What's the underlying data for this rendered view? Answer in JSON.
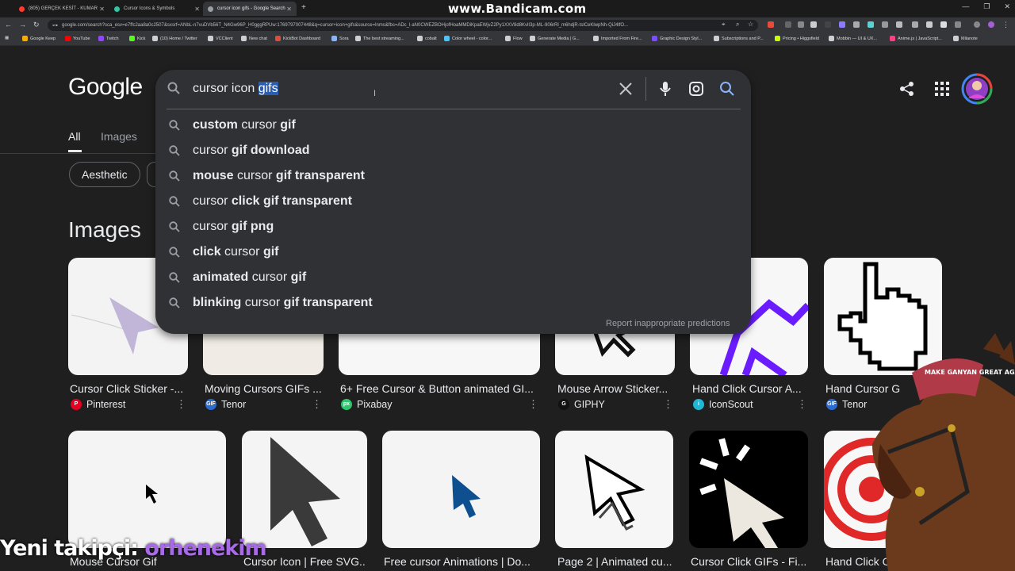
{
  "browser": {
    "tabs": [
      {
        "title": "(805) GERÇEK KESİT - KUMAR",
        "color": "#ff3b30"
      },
      {
        "title": "Cursor Icons & Symbols",
        "color": "#35c4a6"
      },
      {
        "title": "cursor icon gifs - Google Search",
        "color": "#9aa0a6"
      }
    ],
    "new_tab": "+",
    "watermark": "www.Bandicam.com",
    "url": "google.com/search?sca_esv=e7ffc2aa8a0c2507&sxsrf=ANbL-n7vuDVb56T_N4Gw96P_H0gggRPUw:1769797007448&q=cursor+icon+gifs&source=lnms&fbs=ADc_l-aN0CWEZBOHjofHoaMMDiKpaEWjvZ2Py1XXV8d8KvlI3p-ML-906rRl_m6hdjR-tslCeKlwpNh-QiJ4lfO...",
    "bookmarks": [
      {
        "label": "Google Keep",
        "color": "#f9ab00"
      },
      {
        "label": "YouTube",
        "color": "#ff0000"
      },
      {
        "label": "Twitch",
        "color": "#9146ff"
      },
      {
        "label": "Kick",
        "color": "#53fc18"
      },
      {
        "label": "(10) Home / Twitter",
        "color": "#cfcfcf"
      },
      {
        "label": "VCClient",
        "color": "#cfcfcf"
      },
      {
        "label": "New chat",
        "color": "#cfcfcf"
      },
      {
        "label": "KickBot Dashboard",
        "color": "#e04b3a"
      },
      {
        "label": "Sora",
        "color": "#8ab4f8"
      },
      {
        "label": "The best streaming...",
        "color": "#cfcfcf"
      },
      {
        "label": "cobalt",
        "color": "#cfcfcf"
      },
      {
        "label": "Color wheel - color...",
        "color": "#4fc3f7"
      },
      {
        "label": "Flow",
        "color": "#cfcfcf"
      },
      {
        "label": "Generate Media | G...",
        "color": "#cfcfcf"
      },
      {
        "label": "Imported From Fire...",
        "color": "#cfcfcf"
      },
      {
        "label": "Graphic Design Styl...",
        "color": "#7c4dff"
      },
      {
        "label": "Subscriptions and P...",
        "color": "#cfcfcf"
      },
      {
        "label": "Pricing • Higgsfield",
        "color": "#c6ff00"
      },
      {
        "label": "Mobbin — UI & UX...",
        "color": "#cfcfcf"
      },
      {
        "label": "Anime.js | JavaScript...",
        "color": "#ff4081"
      },
      {
        "label": "Milanote",
        "color": "#cfcfcf"
      }
    ]
  },
  "logo": "Google",
  "search": {
    "query_plain": "cursor icon ",
    "query_selected": "gifs",
    "suggestions": [
      [
        {
          "t": "custom",
          "b": true
        },
        {
          "t": " cursor ",
          "b": false
        },
        {
          "t": "gif",
          "b": true
        }
      ],
      [
        {
          "t": "cursor ",
          "b": false
        },
        {
          "t": "gif download",
          "b": true
        }
      ],
      [
        {
          "t": "mouse",
          "b": true
        },
        {
          "t": " cursor ",
          "b": false
        },
        {
          "t": "gif transparent",
          "b": true
        }
      ],
      [
        {
          "t": "cursor ",
          "b": false
        },
        {
          "t": "click gif transparent",
          "b": true
        }
      ],
      [
        {
          "t": "cursor ",
          "b": false
        },
        {
          "t": "gif png",
          "b": true
        }
      ],
      [
        {
          "t": "click",
          "b": true
        },
        {
          "t": " cursor ",
          "b": false
        },
        {
          "t": "gif",
          "b": true
        }
      ],
      [
        {
          "t": "animated",
          "b": true
        },
        {
          "t": " cursor ",
          "b": false
        },
        {
          "t": "gif",
          "b": true
        }
      ],
      [
        {
          "t": "blinking",
          "b": true
        },
        {
          "t": " cursor ",
          "b": false
        },
        {
          "t": "gif transparent",
          "b": true
        }
      ]
    ],
    "report": "Report inappropriate predictions"
  },
  "tabs": {
    "all": "All",
    "images": "Images"
  },
  "chips": {
    "aesthetic": "Aesthetic"
  },
  "section_title": "Images",
  "row1": [
    {
      "caption": "Cursor Click Sticker -...",
      "source": "Pinterest",
      "src_color": "#e60023",
      "src_letter": "P"
    },
    {
      "caption": "Moving Cursors GIFs ...",
      "source": "Tenor",
      "src_color": "#2b6cd4",
      "src_letter": "GIF"
    },
    {
      "caption": "6+ Free Cursor & Button animated GI...",
      "source": "Pixabay",
      "src_color": "#2ec66d",
      "src_letter": "px"
    },
    {
      "caption": "Mouse Arrow Sticker...",
      "source": "GIPHY",
      "src_color": "#111111",
      "src_letter": "G"
    },
    {
      "caption": "Hand Click Cursor A...",
      "source": "IconScout",
      "src_color": "#1fb7d4",
      "src_letter": "i"
    },
    {
      "caption": "Hand Cursor G",
      "source": "Tenor",
      "src_color": "#2b6cd4",
      "src_letter": "GIF"
    }
  ],
  "row2": [
    {
      "caption": "Mouse Cursor Gif"
    },
    {
      "caption": "Cursor Icon | Free SVG..."
    },
    {
      "caption": "Free cursor Animations | Do..."
    },
    {
      "caption": "Page 2 | Animated cu..."
    },
    {
      "caption": "Cursor Click GIFs - Fi..."
    },
    {
      "caption": "Hand Click Cursor A..."
    }
  ],
  "overlay": {
    "prefix": "Yeni takipçi: ",
    "name": "orhenekim"
  },
  "horse_hat_text": "MAKE GANYAN GREAT AGAIN"
}
